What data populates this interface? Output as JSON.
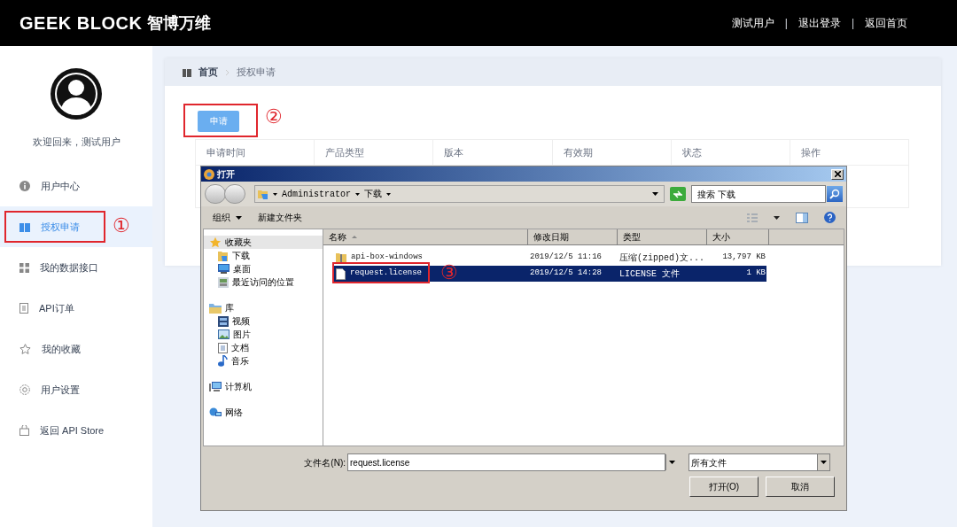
{
  "header": {
    "logo": "GEEK BLOCK",
    "logo_cn": "智博万维",
    "nav": [
      {
        "kind": "link",
        "text": "测试用户"
      },
      {
        "kind": "separator",
        "text": "|"
      },
      {
        "kind": "link",
        "text": "退出登录"
      },
      {
        "kind": "separator",
        "text": "|"
      },
      {
        "kind": "link",
        "text": "返回首页"
      }
    ]
  },
  "sidebar": {
    "welcome": "欢迎回来，测试用户",
    "items": [
      {
        "label": "用户中心",
        "selected": false
      },
      {
        "label": "授权申请",
        "selected": true,
        "annotation": "①"
      },
      {
        "label": "我的数据接口",
        "selected": false
      },
      {
        "label": "API订单",
        "selected": false
      },
      {
        "label": "我的收藏",
        "selected": false
      },
      {
        "label": "用户设置",
        "selected": false
      },
      {
        "label": "返回 API Store",
        "selected": false
      }
    ]
  },
  "breadcrumb": [
    "首页",
    "授权申请"
  ],
  "apply_button": {
    "label": "申请",
    "annotation": "②"
  },
  "table": {
    "columns": [
      "申请时间",
      "产品类型",
      "版本",
      "有效期",
      "状态",
      "操作"
    ]
  },
  "dialog": {
    "title": "打开",
    "path": [
      "Administrator",
      "下载"
    ],
    "search": {
      "placeholder": "搜索 下载"
    },
    "toolbar": [
      {
        "label": "组织",
        "dropdown": true
      },
      {
        "label": "新建文件夹",
        "dropdown": false
      }
    ],
    "tree": [
      {
        "label": "收藏夹",
        "selected": true,
        "children": [
          {
            "label": "下载",
            "selected": false
          },
          {
            "label": "桌面",
            "selected": false
          },
          {
            "label": "最近访问的位置",
            "selected": false
          }
        ]
      },
      {
        "label": "库",
        "selected": false,
        "children": [
          {
            "label": "视频",
            "selected": false
          },
          {
            "label": "图片",
            "selected": false
          },
          {
            "label": "文档",
            "selected": false
          },
          {
            "label": "音乐",
            "selected": false
          }
        ]
      },
      {
        "label": "计算机",
        "selected": false
      },
      {
        "label": "网络",
        "selected": false
      }
    ],
    "columns": [
      "名称",
      "修改日期",
      "类型",
      "大小"
    ],
    "files": [
      {
        "name": "api-box-windows",
        "date": "2019/12/5 11:16",
        "type": "压缩(zipped)文...",
        "size": "13,797 KB",
        "selected": false
      },
      {
        "name": "request.license",
        "date": "2019/12/5 14:28",
        "type": "LICENSE 文件",
        "size": "1 KB",
        "selected": true,
        "annotation": "③"
      }
    ],
    "filename_label": "文件名(N):",
    "filename": "request.license",
    "filetype": "所有文件",
    "buttons": [
      "打开(O)",
      "取消"
    ]
  }
}
